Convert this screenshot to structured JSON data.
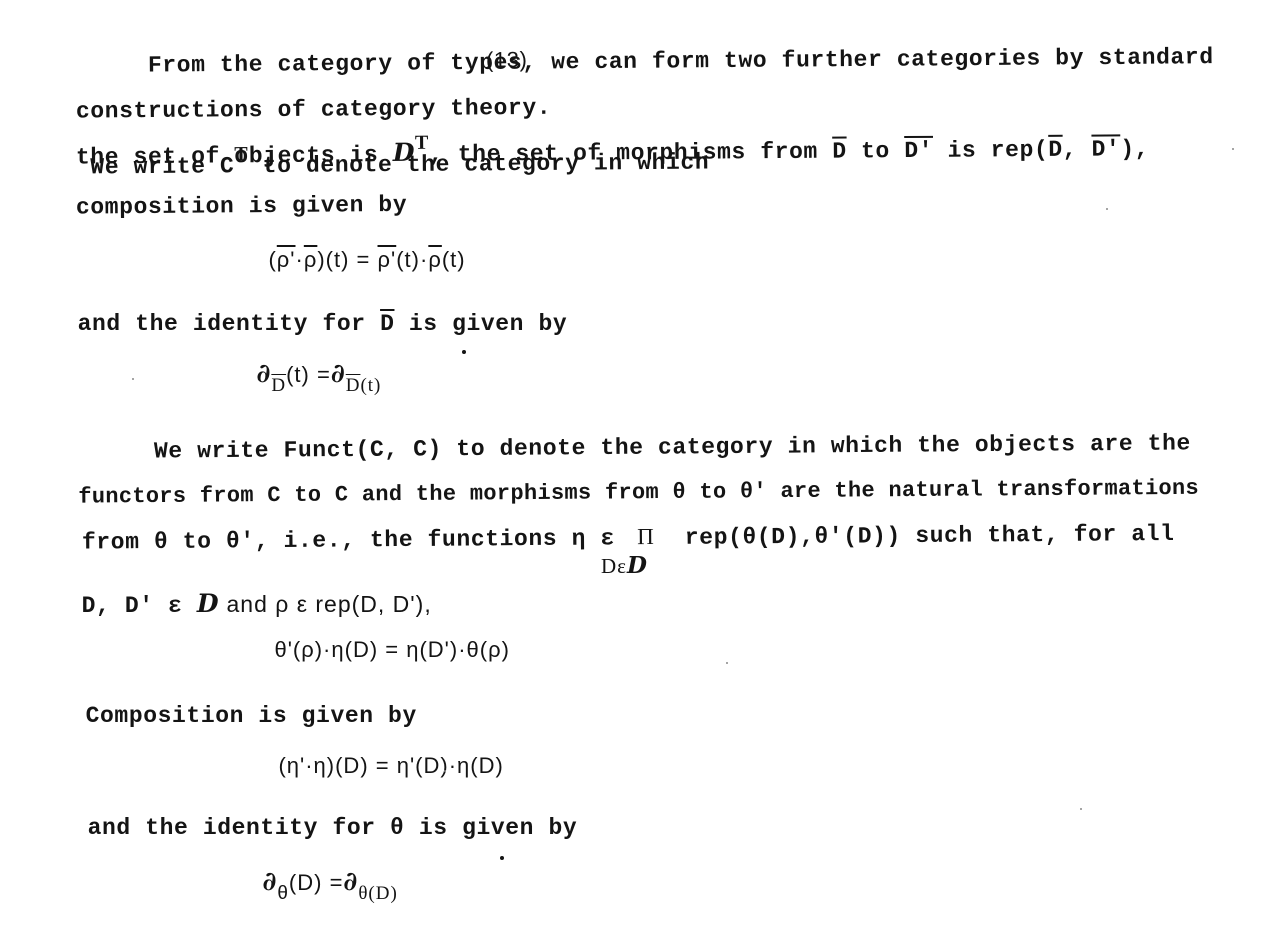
{
  "paragraph1": {
    "line1": "From the category of types, we can form two further categories by standard",
    "line2_before": "constructions of category theory.",
    "footnote_ref": "(13)",
    "line2_after": "We write C",
    "line2_sup": "T",
    "line2_end": " to denote the category in which",
    "line3_start": "the set of objects is ",
    "line3_script": "D",
    "line3_sup": "T",
    "line3_mid1": ", the set of morphisms from ",
    "line3_D": "D",
    "line3_to": " to ",
    "line3_Dp": "D'",
    "line3_is": " is rep(",
    "line3_D2": "D",
    "line3_comma": ", ",
    "line3_Dp2": "D'",
    "line3_end": "),",
    "line4": "composition is given by"
  },
  "formula1": {
    "open": "(",
    "rho_p": "ρ'",
    "cdot": "·",
    "rho": "ρ",
    "close": ")(t) = ",
    "rho_p2": "ρ'",
    "t1": "(t)·",
    "rho2": "ρ",
    "t2": "(t)"
  },
  "identity1": {
    "text_start": "and the identity for ",
    "D": "D",
    "text_end": " is given by"
  },
  "formula2": {
    "sym": "∂",
    "sub1": "D",
    "mid": "(t) =",
    "sym2": "∂",
    "sub2": "D",
    "sub2_end": "(t)"
  },
  "paragraph2": {
    "line1": "We write Funct(C, C) to denote the category in which the objects are the",
    "line2": "functors from C to C and the morphisms from θ to θ' are the natural transformations",
    "line3_start": "from θ to θ', i.e., the functions η ε ",
    "product": "Π",
    "line3_end": " rep(θ(D),θ'(D)) such that, for all",
    "product_sub": "Dε",
    "product_sub_script": "D",
    "line4_start": "D, D' ε ",
    "line4_script": "D",
    "line4_end": " and ρ ε rep(D, D'),"
  },
  "formula3": "θ'(ρ)·η(D) = η(D')·θ(ρ)",
  "composition_label": "Composition is given by",
  "formula4": "(η'·η)(D) = η'(D)·η(D)",
  "identity2": "and the identity for θ is given by",
  "formula5": {
    "sym": "∂",
    "sub1": "θ",
    "mid": "(D) =",
    "sym2": "∂",
    "sub2": "θ(D)"
  }
}
